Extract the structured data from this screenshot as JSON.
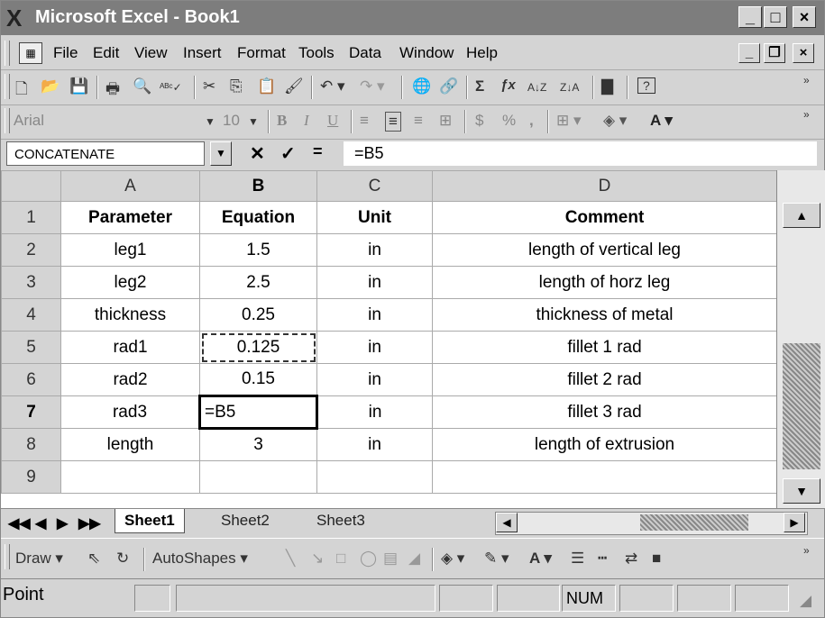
{
  "window": {
    "title": "Microsoft Excel - Book1",
    "app_icon": "X",
    "min": "_",
    "max": "□",
    "close": "×"
  },
  "menu": {
    "items": [
      "File",
      "Edit",
      "View",
      "Insert",
      "Format",
      "Tools",
      "Data",
      "Window",
      "Help"
    ],
    "doc_min": "_",
    "doc_restore": "❐",
    "doc_close": "×"
  },
  "standard_toolbar": {
    "icons": [
      "new-icon",
      "open-icon",
      "save-icon",
      "print-icon",
      "print-preview-icon",
      "spelling-icon",
      "cut-icon",
      "copy-icon",
      "paste-icon",
      "format-painter-icon",
      "undo-icon",
      "redo-icon",
      "hyperlink-icon",
      "web-icon",
      "autosum-icon",
      "function-icon",
      "sort-ascending-icon",
      "sort-descending-icon",
      "chart-wizard-icon",
      "help-icon"
    ],
    "glyphs": {
      "new": "🗋",
      "open": "📂",
      "save": "💾",
      "print": "🖶",
      "preview": "🔍",
      "spell": "ᴬᴮᶜ✓",
      "cut": "✂",
      "copy": "⎘",
      "paste": "📋",
      "painter": "🖌",
      "undo": "↶ ▾",
      "redo": "↷ ▾",
      "link": "🌐",
      "web": "🔗",
      "sum": "Σ",
      "fx": "ƒx",
      "az": "A↓Z",
      "za": "Z↓A",
      "chart": "▇",
      "help": "?"
    }
  },
  "formatting_toolbar": {
    "font": "Arial",
    "size": "10",
    "bold": "B",
    "italic": "I",
    "underline": "U",
    "align_glyphs": [
      "≡",
      "≡",
      "≡",
      "⊞"
    ],
    "currency": "$",
    "percent": "%",
    "comma": ",",
    "borders": "⊞ ▾",
    "fill": "◈ ▾",
    "font_color": "A ▾"
  },
  "formula_bar": {
    "name_box": "CONCATENATE",
    "cancel": "✕",
    "enter": "✓",
    "equals": "=",
    "content": "=B5"
  },
  "grid": {
    "columns": [
      "A",
      "B",
      "C",
      "D"
    ],
    "active_column": "B",
    "active_row": "7",
    "rows": [
      {
        "num": "1",
        "cells": [
          "Parameter",
          "Equation",
          "Unit",
          "Comment"
        ]
      },
      {
        "num": "2",
        "cells": [
          "leg1",
          "1.5",
          "in",
          "length of vertical leg"
        ]
      },
      {
        "num": "3",
        "cells": [
          "leg2",
          "2.5",
          "in",
          "length of horz leg"
        ]
      },
      {
        "num": "4",
        "cells": [
          "thickness",
          "0.25",
          "in",
          "thickness of metal"
        ]
      },
      {
        "num": "5",
        "cells": [
          "rad1",
          "0.125",
          "in",
          "fillet 1 rad"
        ]
      },
      {
        "num": "6",
        "cells": [
          "rad2",
          "0.15",
          "in",
          "fillet 2 rad"
        ]
      },
      {
        "num": "7",
        "cells": [
          "rad3",
          "=B5",
          "in",
          "fillet 3 rad"
        ]
      },
      {
        "num": "8",
        "cells": [
          "length",
          "3",
          "in",
          "length of extrusion"
        ]
      },
      {
        "num": "9",
        "cells": [
          "",
          "",
          "",
          ""
        ]
      }
    ]
  },
  "sheet_tabs": {
    "nav": [
      "◀◀",
      "◀",
      "▶",
      "▶▶"
    ],
    "tabs": [
      "Sheet1",
      "Sheet2",
      "Sheet3"
    ],
    "active": "Sheet1"
  },
  "draw_toolbar": {
    "draw": "Draw ▾",
    "autoshapes": "AutoShapes ▾"
  },
  "status": {
    "mode": "Point",
    "num": "NUM"
  }
}
